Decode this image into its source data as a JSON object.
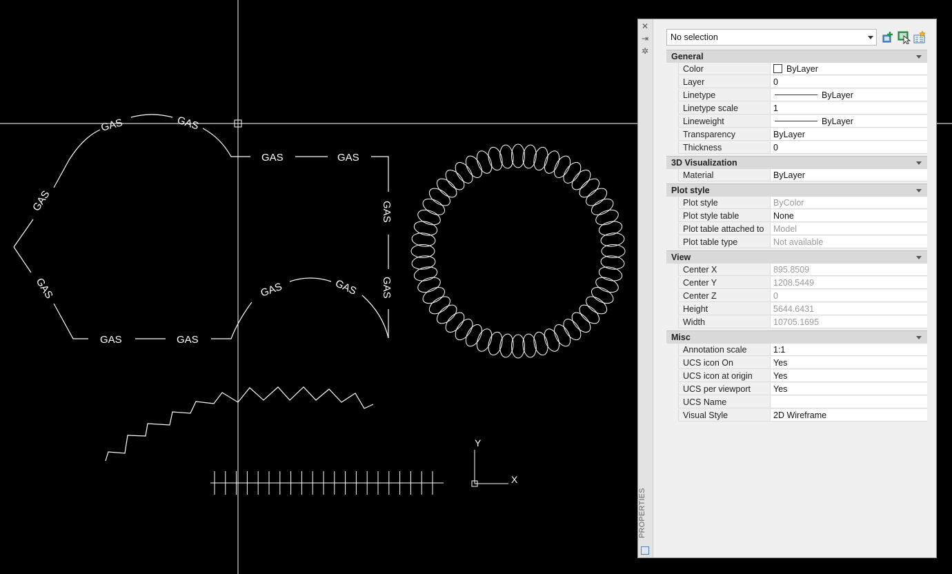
{
  "drawing": {
    "pipe_label": "GAS",
    "ucs_y": "Y",
    "ucs_x": "X"
  },
  "palette": {
    "title": "PROPERTIES",
    "selection": "No selection",
    "sections": [
      {
        "title": "General",
        "rows": [
          {
            "label": "Color",
            "value": "ByLayer",
            "kind": "color"
          },
          {
            "label": "Layer",
            "value": "0"
          },
          {
            "label": "Linetype",
            "value": "ByLayer",
            "kind": "line"
          },
          {
            "label": "Linetype scale",
            "value": "1"
          },
          {
            "label": "Lineweight",
            "value": "ByLayer",
            "kind": "line"
          },
          {
            "label": "Transparency",
            "value": "ByLayer"
          },
          {
            "label": "Thickness",
            "value": "0"
          }
        ]
      },
      {
        "title": "3D Visualization",
        "rows": [
          {
            "label": "Material",
            "value": "ByLayer"
          }
        ]
      },
      {
        "title": "Plot style",
        "rows": [
          {
            "label": "Plot style",
            "value": "ByColor",
            "readonly": true
          },
          {
            "label": "Plot style table",
            "value": "None"
          },
          {
            "label": "Plot table attached to",
            "value": "Model",
            "readonly": true
          },
          {
            "label": "Plot table type",
            "value": "Not available",
            "readonly": true
          }
        ]
      },
      {
        "title": "View",
        "rows": [
          {
            "label": "Center X",
            "value": "895.8509",
            "readonly": true
          },
          {
            "label": "Center Y",
            "value": "1208.5449",
            "readonly": true
          },
          {
            "label": "Center Z",
            "value": "0",
            "readonly": true
          },
          {
            "label": "Height",
            "value": "5644.6431",
            "readonly": true
          },
          {
            "label": "Width",
            "value": "10705.1695",
            "readonly": true
          }
        ]
      },
      {
        "title": "Misc",
        "rows": [
          {
            "label": "Annotation scale",
            "value": "1:1"
          },
          {
            "label": "UCS icon On",
            "value": "Yes"
          },
          {
            "label": "UCS icon at origin",
            "value": "Yes"
          },
          {
            "label": "UCS per viewport",
            "value": "Yes"
          },
          {
            "label": "UCS Name",
            "value": ""
          },
          {
            "label": "Visual Style",
            "value": "2D Wireframe"
          }
        ]
      }
    ]
  },
  "colors": {
    "canvas": "#000000",
    "geometry": "#ffffff",
    "panel": "#f0f0f0"
  }
}
